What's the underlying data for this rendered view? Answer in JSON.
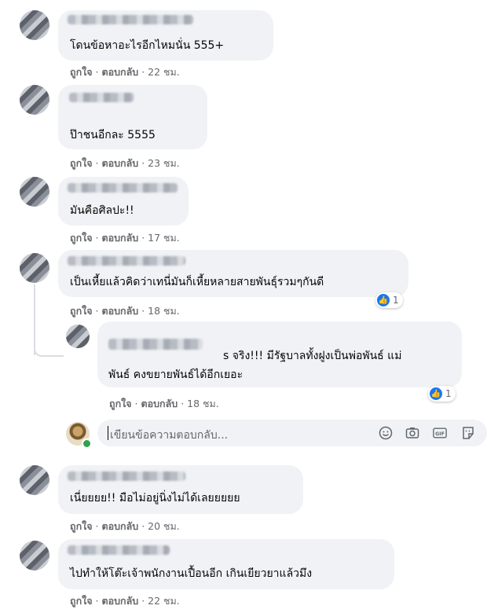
{
  "actions": {
    "like": "ถูกใจ",
    "reply": "ตอบกลับ"
  },
  "comments": [
    {
      "text": "โดนข้อหาอะไรอีกไหมนั่น 555+",
      "time": "22 ชม."
    },
    {
      "text": "ป๊าชนอีกละ 5555",
      "time": "23 ชม."
    },
    {
      "text": "มันคือศิลปะ!!",
      "time": "17 ชม."
    },
    {
      "text": "เป็นเหี้ยแล้วคิดว่าเทนี่มันก็เหี้ยหลายสายพันธุ์รวมๆกันดี",
      "time": "18 ชม.",
      "reactions": "1"
    },
    {
      "text": "เนี่ยยยย!! มือไม่อยู่นิ่งไม่ได้เลยยยยย",
      "time": "20 ชม."
    },
    {
      "text": "ไปทำให้โต๊ะเจ้าพนักงานเปื้อนอีก เกินเยียวยาแล้วมึง",
      "time": "22 ชม."
    }
  ],
  "reply": {
    "line1": "s จริง!!! มีรัฐบาลทั้งฝูงเป็นพ่อพันธ์ แม่",
    "line2": "พันธ์ คงขยายพันธ์ได้อีกเยอะ",
    "time": "18 ชม.",
    "reactions": "1"
  },
  "reply_box": {
    "placeholder": "เขียนข้อความตอบกลับ..."
  },
  "icons": [
    "emoji-icon",
    "camera-icon",
    "gif-icon",
    "sticker-icon"
  ],
  "colors": {
    "bubble": "#f0f2f5",
    "like": "#1877f2",
    "meta": "#65676b"
  }
}
